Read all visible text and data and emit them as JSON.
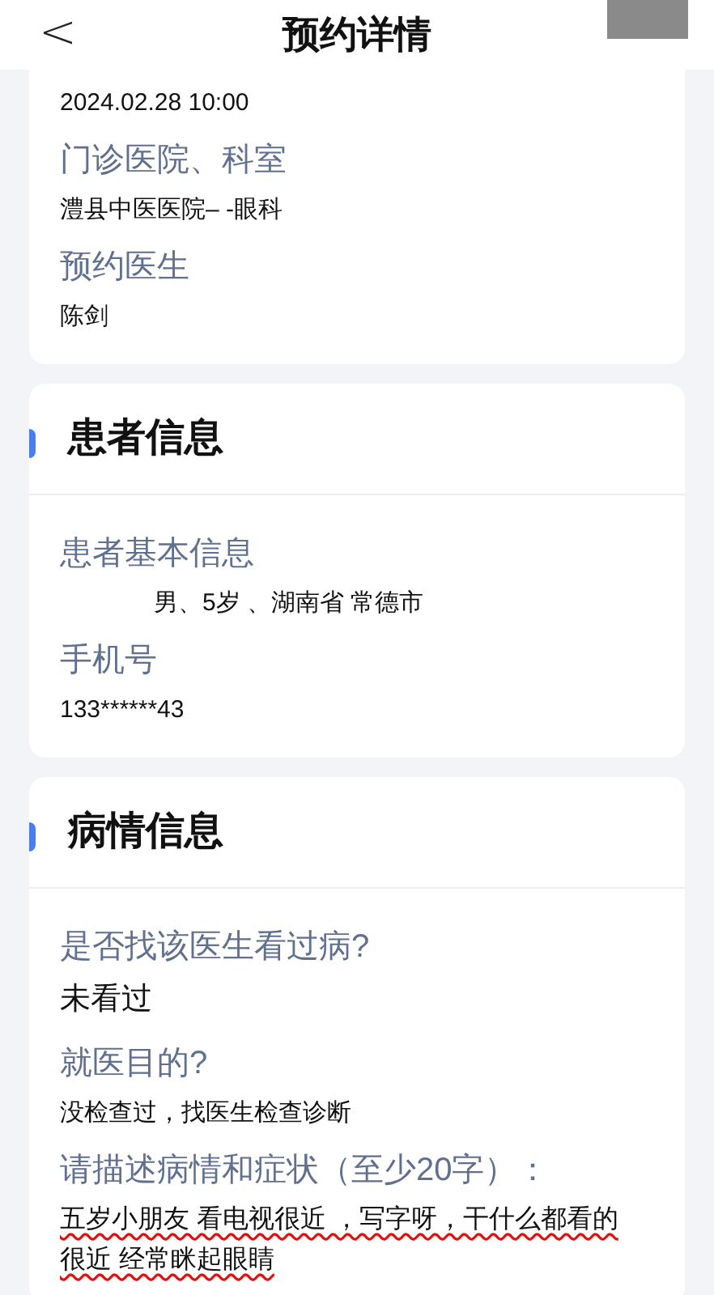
{
  "header": {
    "back": "<",
    "title": "预约详情"
  },
  "sections": [
    {
      "fields": [
        {
          "kind": "text",
          "value": "2024.02.28 10:00"
        },
        {
          "kind": "text",
          "label": "门诊医院、科室",
          "value": "澧县中医医院– -眼科"
        },
        {
          "kind": "text",
          "label": "预约医生",
          "value": "陈剑"
        }
      ]
    },
    {
      "title": "患者信息",
      "fields": [
        {
          "kind": "redacted",
          "label": "患者基本信息",
          "value": "男、5岁 、湖南省 常德市"
        },
        {
          "kind": "text",
          "label": "手机号",
          "value": "133******43"
        }
      ]
    },
    {
      "title": "病情信息",
      "fields": [
        {
          "kind": "large",
          "label": "是否找该医生看过病?",
          "value": "未看过"
        },
        {
          "kind": "text",
          "label": "就医目的?",
          "value": "没检查过，找医生检查诊断"
        },
        {
          "kind": "misspelled",
          "label": "请描述病情和症状（至少20字）：",
          "value": "五岁小朋友 看电视很近 ，写字呀，干什么都看的很近 经常眯起眼睛"
        }
      ]
    }
  ]
}
